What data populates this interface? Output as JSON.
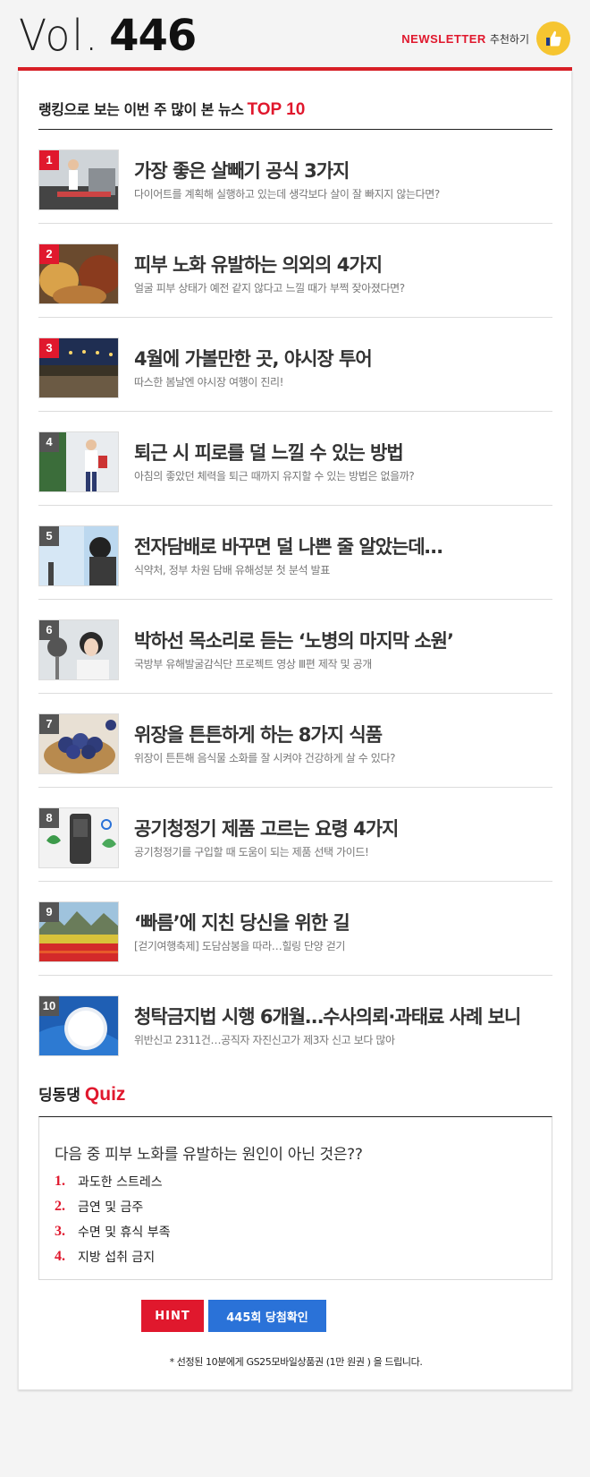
{
  "header": {
    "vol_prefix": "Vol.",
    "vol_number": "446",
    "newsletter_label": "NEWSLETTER",
    "recommend_label": "추천하기",
    "thumb_icon": "thumbs-up-icon",
    "accent_color": "#e0182d"
  },
  "ranking": {
    "title": "랭킹으로 보는 이번 주 많이 본 뉴스",
    "title_highlight": "TOP 10",
    "items": [
      {
        "rank": "1",
        "title": "가장 좋은 살빼기 공식 3가지",
        "subtitle": "다이어트를 계획해 실행하고 있는데 생각보다 살이 잘 빠지지 않는다면?"
      },
      {
        "rank": "2",
        "title": "피부 노화 유발하는 의외의 4가지",
        "subtitle": "얼굴 피부 상태가 예전 같지 않다고 느낄 때가 부쩍 잦아졌다면?"
      },
      {
        "rank": "3",
        "title": "4월에 가볼만한 곳, 야시장 투어",
        "subtitle": "따스한 봄날엔 야시장 여행이 진리!"
      },
      {
        "rank": "4",
        "title": "퇴근 시 피로를 덜 느낄 수 있는 방법",
        "subtitle": "아침의 좋았던 체력을 퇴근 때까지 유지할 수 있는 방법은 없을까?"
      },
      {
        "rank": "5",
        "title": "전자담배로 바꾸면 덜 나쁜 줄 알았는데…",
        "subtitle": "식약처, 정부 차원 담배 유해성분 첫 분석 발표"
      },
      {
        "rank": "6",
        "title": "박하선 목소리로 듣는 ‘노병의 마지막 소원’",
        "subtitle": "국방부 유해발굴감식단 프로젝트 영상 Ⅲ편 제작 및 공개"
      },
      {
        "rank": "7",
        "title": "위장을 튼튼하게 하는 8가지 식품",
        "subtitle": "위장이 튼튼해 음식물 소화를 잘 시켜야 건강하게 살 수 있다?"
      },
      {
        "rank": "8",
        "title": "공기청정기 제품 고르는 요령 4가지",
        "subtitle": "공기청정기를 구입할 때 도움이 되는 제품 선택 가이드!"
      },
      {
        "rank": "9",
        "title": "‘빠름’에 지친 당신을 위한 길",
        "subtitle": "[걷기여행축제] 도담삼봉을 따라…힐링 단양 걷기"
      },
      {
        "rank": "10",
        "title": "청탁금지법 시행 6개월…수사의뢰·과태료 사례 보니",
        "subtitle": "위반신고 2311건…공직자 자진신고가 제3자 신고 보다 많아"
      }
    ]
  },
  "quiz": {
    "title": "딩동댕",
    "title_highlight": "Quiz",
    "question": "다음 중 피부 노화를 유발하는 원인이 아닌 것은??",
    "options": [
      {
        "num": "1.",
        "label": "과도한 스트레스"
      },
      {
        "num": "2.",
        "label": "금연 및 금주"
      },
      {
        "num": "3.",
        "label": "수면 및 휴식 부족"
      },
      {
        "num": "4.",
        "label": "지방 섭취 금지"
      }
    ],
    "hint_button": "HINT",
    "check_button": "445회 당첨확인",
    "notice": "* 선정된 10분에게 GS25모바일상품권 (1만 원권 ) 을 드립니다."
  }
}
